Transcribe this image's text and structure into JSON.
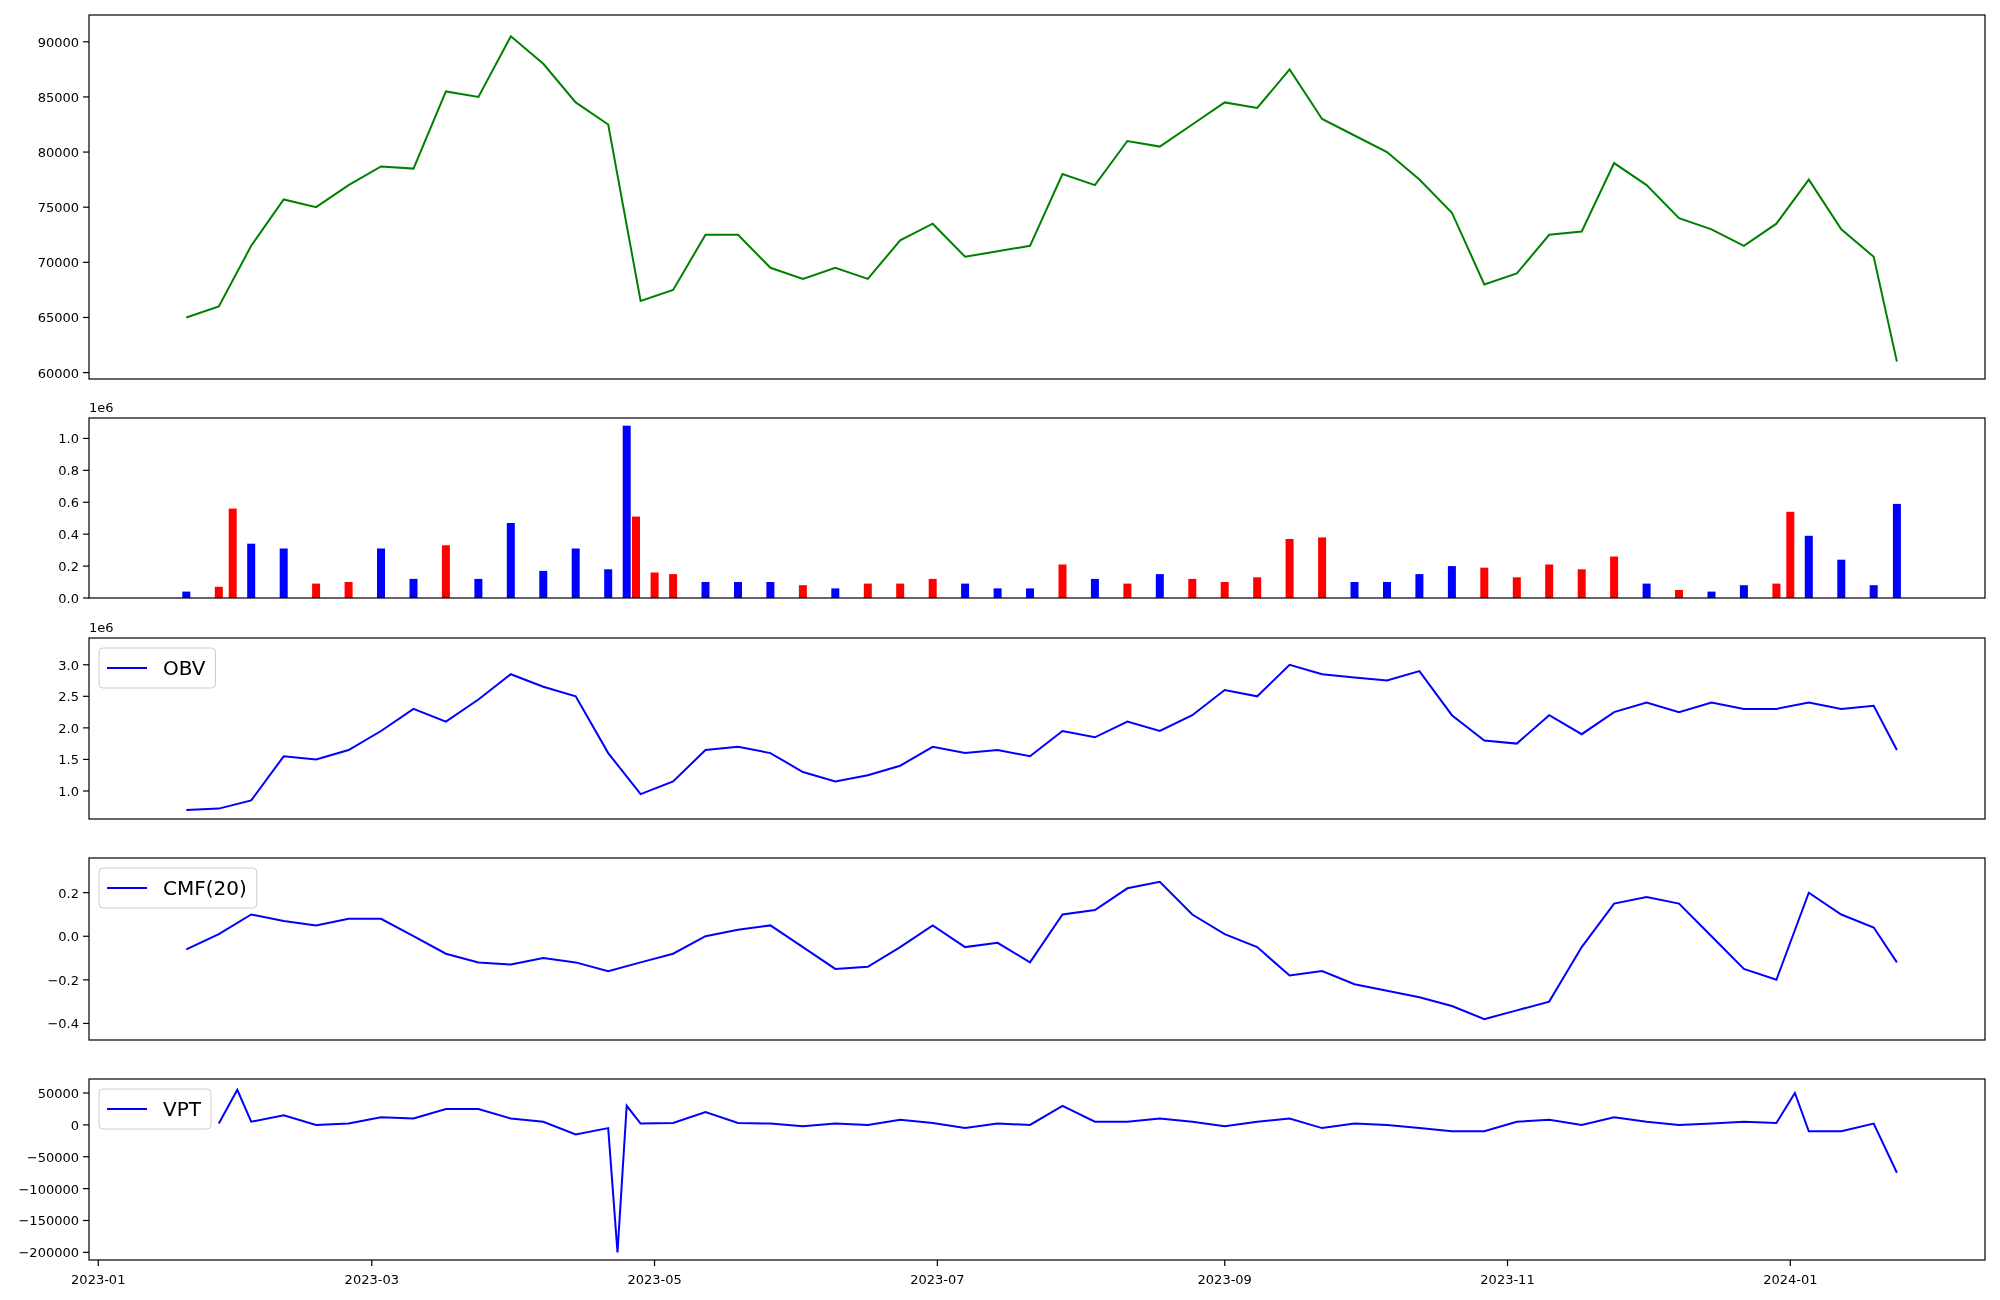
{
  "panels": [
    {
      "chart_data": {
        "type": "line",
        "x": [
          "2023-01-20",
          "2023-01-27",
          "2023-02-03",
          "2023-02-10",
          "2023-02-17",
          "2023-02-24",
          "2023-03-03",
          "2023-03-10",
          "2023-03-17",
          "2023-03-24",
          "2023-03-31",
          "2023-04-07",
          "2023-04-14",
          "2023-04-21",
          "2023-04-28",
          "2023-05-05",
          "2023-05-12",
          "2023-05-19",
          "2023-05-26",
          "2023-06-02",
          "2023-06-09",
          "2023-06-16",
          "2023-06-23",
          "2023-06-30",
          "2023-07-07",
          "2023-07-14",
          "2023-07-21",
          "2023-07-28",
          "2023-08-04",
          "2023-08-11",
          "2023-08-18",
          "2023-08-25",
          "2023-09-01",
          "2023-09-08",
          "2023-09-15",
          "2023-09-22",
          "2023-09-29",
          "2023-10-06",
          "2023-10-13",
          "2023-10-20",
          "2023-10-27",
          "2023-11-03",
          "2023-11-10",
          "2023-11-17",
          "2023-11-24",
          "2023-12-01",
          "2023-12-08",
          "2023-12-15",
          "2023-12-22",
          "2023-12-29",
          "2024-01-05",
          "2024-01-12",
          "2024-01-19",
          "2024-01-24"
        ],
        "series": [
          {
            "color": "#008000",
            "values": [
              65000,
              66000,
              71500,
              75700,
              75000,
              77000,
              78700,
              78500,
              85500,
              85000,
              90500,
              88000,
              84500,
              82500,
              66500,
              67500,
              72500,
              72500,
              69500,
              68500,
              69500,
              68500,
              72000,
              73500,
              70500,
              71000,
              71500,
              78000,
              77000,
              81000,
              80500,
              82500,
              84500,
              84000,
              87500,
              83000,
              81500,
              80000,
              77500,
              74500,
              68000,
              69000,
              72500,
              72800,
              79000,
              77000,
              74000,
              73000,
              71500,
              73500,
              77500,
              73000,
              70500,
              61000
            ]
          }
        ],
        "xlim": [
          "2022-12-30",
          "2024-02-12"
        ],
        "ylim": [
          59420,
          92430
        ],
        "yticks": [
          60000,
          65000,
          70000,
          75000,
          80000,
          85000,
          90000
        ]
      }
    },
    {
      "offset_label": "1e6",
      "chart_data": {
        "type": "bar",
        "x": [
          "2023-01-20",
          "2023-01-27",
          "2023-01-30",
          "2023-02-03",
          "2023-02-10",
          "2023-02-17",
          "2023-02-24",
          "2023-03-03",
          "2023-03-10",
          "2023-03-17",
          "2023-03-24",
          "2023-03-31",
          "2023-04-07",
          "2023-04-14",
          "2023-04-21",
          "2023-04-25",
          "2023-04-27",
          "2023-05-01",
          "2023-05-05",
          "2023-05-12",
          "2023-05-19",
          "2023-05-26",
          "2023-06-02",
          "2023-06-09",
          "2023-06-16",
          "2023-06-23",
          "2023-06-30",
          "2023-07-07",
          "2023-07-14",
          "2023-07-21",
          "2023-07-28",
          "2023-08-04",
          "2023-08-11",
          "2023-08-18",
          "2023-08-25",
          "2023-09-01",
          "2023-09-08",
          "2023-09-15",
          "2023-09-22",
          "2023-09-29",
          "2023-10-06",
          "2023-10-13",
          "2023-10-20",
          "2023-10-27",
          "2023-11-03",
          "2023-11-10",
          "2023-11-17",
          "2023-11-24",
          "2023-12-01",
          "2023-12-08",
          "2023-12-15",
          "2023-12-22",
          "2023-12-29",
          "2024-01-01",
          "2024-01-05",
          "2024-01-12",
          "2024-01-19",
          "2024-01-24"
        ],
        "series": [
          {
            "color": "#0000ff",
            "values": [
              0.04,
              null,
              null,
              0.34,
              0.31,
              null,
              null,
              0.31,
              0.12,
              null,
              0.12,
              0.47,
              0.17,
              0.31,
              0.18,
              1.08,
              null,
              null,
              null,
              0.1,
              0.1,
              0.1,
              null,
              0.06,
              null,
              null,
              null,
              0.09,
              0.06,
              0.06,
              null,
              0.12,
              null,
              0.15,
              null,
              null,
              null,
              null,
              null,
              0.1,
              0.1,
              0.15,
              0.2,
              null,
              null,
              null,
              null,
              null,
              0.09,
              null,
              0.04,
              0.08,
              null,
              null,
              0.39,
              0.24,
              0.08,
              0.59
            ]
          },
          {
            "color": "#ff0000",
            "values": [
              null,
              0.07,
              0.56,
              null,
              null,
              0.09,
              0.1,
              null,
              null,
              0.33,
              null,
              null,
              null,
              null,
              null,
              null,
              0.51,
              0.16,
              0.15,
              null,
              null,
              null,
              0.08,
              null,
              0.09,
              0.09,
              0.12,
              null,
              null,
              null,
              0.21,
              null,
              0.09,
              null,
              0.12,
              0.1,
              0.13,
              0.37,
              0.38,
              null,
              null,
              null,
              null,
              0.19,
              0.13,
              0.21,
              0.18,
              0.26,
              null,
              0.05,
              null,
              null,
              0.09,
              0.54,
              null,
              null,
              null,
              null
            ]
          }
        ],
        "xlim": [
          "2022-12-30",
          "2024-02-12"
        ],
        "ylim": [
          0,
          1.128
        ],
        "yticks": [
          {
            "value": 0,
            "label": "0.0"
          },
          {
            "value": 0.2,
            "label": "0.2"
          },
          {
            "value": 0.4,
            "label": "0.4"
          },
          {
            "value": 0.6,
            "label": "0.6"
          },
          {
            "value": 0.8,
            "label": "0.8"
          },
          {
            "value": 1,
            "label": "1.0"
          }
        ]
      }
    },
    {
      "offset_label": "1e6",
      "chart_data": {
        "type": "line",
        "x": [
          "2023-01-20",
          "2023-01-27",
          "2023-02-03",
          "2023-02-10",
          "2023-02-17",
          "2023-02-24",
          "2023-03-03",
          "2023-03-10",
          "2023-03-17",
          "2023-03-24",
          "2023-03-31",
          "2023-04-07",
          "2023-04-14",
          "2023-04-21",
          "2023-04-28",
          "2023-05-05",
          "2023-05-12",
          "2023-05-19",
          "2023-05-26",
          "2023-06-02",
          "2023-06-09",
          "2023-06-16",
          "2023-06-23",
          "2023-06-30",
          "2023-07-07",
          "2023-07-14",
          "2023-07-21",
          "2023-07-28",
          "2023-08-04",
          "2023-08-11",
          "2023-08-18",
          "2023-08-25",
          "2023-09-01",
          "2023-09-08",
          "2023-09-15",
          "2023-09-22",
          "2023-09-29",
          "2023-10-06",
          "2023-10-13",
          "2023-10-20",
          "2023-10-27",
          "2023-11-03",
          "2023-11-10",
          "2023-11-17",
          "2023-11-24",
          "2023-12-01",
          "2023-12-08",
          "2023-12-15",
          "2023-12-22",
          "2023-12-29",
          "2024-01-05",
          "2024-01-12",
          "2024-01-19",
          "2024-01-24"
        ],
        "series": [
          {
            "name": "OBV",
            "color": "#0000ff",
            "values": [
              0.7,
              0.72,
              0.85,
              1.55,
              1.5,
              1.65,
              1.95,
              2.3,
              2.1,
              2.45,
              2.85,
              2.65,
              2.5,
              1.6,
              0.95,
              1.15,
              1.65,
              1.7,
              1.6,
              1.3,
              1.15,
              1.25,
              1.4,
              1.7,
              1.6,
              1.65,
              1.55,
              1.95,
              1.85,
              2.1,
              1.95,
              2.2,
              2.6,
              2.5,
              3.0,
              2.85,
              2.8,
              2.75,
              2.9,
              2.2,
              1.8,
              1.75,
              2.2,
              1.9,
              2.25,
              2.4,
              2.25,
              2.4,
              2.3,
              2.3,
              2.4,
              2.3,
              2.35,
              1.65
            ]
          }
        ],
        "xlim": [
          "2022-12-30",
          "2024-02-12"
        ],
        "ylim": [
          0.556,
          3.424
        ],
        "yticks": [
          {
            "value": 1,
            "label": "1.0"
          },
          {
            "value": 1.5,
            "label": "1.5"
          },
          {
            "value": 2,
            "label": "2.0"
          },
          {
            "value": 2.5,
            "label": "2.5"
          },
          {
            "value": 3,
            "label": "3.0"
          }
        ]
      }
    },
    {
      "chart_data": {
        "type": "line",
        "x": [
          "2023-01-20",
          "2023-01-27",
          "2023-02-03",
          "2023-02-10",
          "2023-02-17",
          "2023-02-24",
          "2023-03-03",
          "2023-03-10",
          "2023-03-17",
          "2023-03-24",
          "2023-03-31",
          "2023-04-07",
          "2023-04-14",
          "2023-04-21",
          "2023-04-28",
          "2023-05-05",
          "2023-05-12",
          "2023-05-19",
          "2023-05-26",
          "2023-06-02",
          "2023-06-09",
          "2023-06-16",
          "2023-06-23",
          "2023-06-30",
          "2023-07-07",
          "2023-07-14",
          "2023-07-21",
          "2023-07-28",
          "2023-08-04",
          "2023-08-11",
          "2023-08-18",
          "2023-08-25",
          "2023-09-01",
          "2023-09-08",
          "2023-09-15",
          "2023-09-22",
          "2023-09-29",
          "2023-10-06",
          "2023-10-13",
          "2023-10-20",
          "2023-10-27",
          "2023-11-03",
          "2023-11-10",
          "2023-11-17",
          "2023-11-24",
          "2023-12-01",
          "2023-12-08",
          "2023-12-15",
          "2023-12-22",
          "2023-12-29",
          "2024-01-05",
          "2024-01-12",
          "2024-01-19",
          "2024-01-24"
        ],
        "series": [
          {
            "name": "CMF(20)",
            "color": "#0000ff",
            "values": [
              -0.06,
              0.01,
              0.1,
              0.07,
              0.05,
              0.08,
              0.08,
              0.0,
              -0.08,
              -0.12,
              -0.13,
              -0.1,
              -0.12,
              -0.16,
              -0.12,
              -0.08,
              0.0,
              0.03,
              0.05,
              -0.05,
              -0.15,
              -0.14,
              -0.05,
              0.05,
              -0.05,
              -0.03,
              -0.12,
              0.1,
              0.12,
              0.22,
              0.25,
              0.1,
              0.01,
              -0.05,
              -0.18,
              -0.16,
              -0.22,
              -0.25,
              -0.28,
              -0.32,
              -0.38,
              -0.34,
              -0.3,
              -0.05,
              0.15,
              0.18,
              0.15,
              0.0,
              -0.15,
              -0.2,
              0.2,
              0.1,
              0.04,
              -0.12
            ]
          }
        ],
        "xlim": [
          "2022-12-30",
          "2024-02-12"
        ],
        "ylim": [
          -0.476,
          0.359
        ],
        "yticks": [
          {
            "value": -0.4,
            "label": "−0.4"
          },
          {
            "value": -0.2,
            "label": "−0.2"
          },
          {
            "value": 0,
            "label": "0.0"
          },
          {
            "value": 0.2,
            "label": "0.2"
          }
        ]
      }
    },
    {
      "chart_data": {
        "type": "line",
        "x": [
          "2023-01-27",
          "2023-01-31",
          "2023-02-03",
          "2023-02-10",
          "2023-02-17",
          "2023-02-24",
          "2023-03-03",
          "2023-03-10",
          "2023-03-17",
          "2023-03-24",
          "2023-03-31",
          "2023-04-07",
          "2023-04-14",
          "2023-04-21",
          "2023-04-23",
          "2023-04-25",
          "2023-04-28",
          "2023-05-05",
          "2023-05-12",
          "2023-05-19",
          "2023-05-26",
          "2023-06-02",
          "2023-06-09",
          "2023-06-16",
          "2023-06-23",
          "2023-06-30",
          "2023-07-07",
          "2023-07-14",
          "2023-07-21",
          "2023-07-28",
          "2023-08-04",
          "2023-08-11",
          "2023-08-18",
          "2023-08-25",
          "2023-09-01",
          "2023-09-08",
          "2023-09-15",
          "2023-09-22",
          "2023-09-29",
          "2023-10-06",
          "2023-10-13",
          "2023-10-20",
          "2023-10-27",
          "2023-11-03",
          "2023-11-10",
          "2023-11-17",
          "2023-11-24",
          "2023-12-01",
          "2023-12-08",
          "2023-12-15",
          "2023-12-22",
          "2023-12-29",
          "2024-01-02",
          "2024-01-05",
          "2024-01-12",
          "2024-01-19",
          "2024-01-24"
        ],
        "series": [
          {
            "name": "VPT",
            "color": "#0000ff",
            "values": [
              2000,
              55000,
              5000,
              15000,
              0,
              2000,
              12000,
              10000,
              25000,
              25000,
              10000,
              5000,
              -15000,
              -5000,
              -200000,
              30000,
              2000,
              3000,
              20000,
              3000,
              2000,
              -2000,
              2000,
              0,
              8000,
              3000,
              -5000,
              2000,
              0,
              30000,
              5000,
              5000,
              10000,
              5000,
              -2000,
              5000,
              10000,
              -5000,
              2000,
              0,
              -5000,
              -10000,
              -10000,
              5000,
              8000,
              0,
              12000,
              5000,
              0,
              2000,
              5000,
              3000,
              50000,
              -10000,
              -10000,
              2000,
              -75000
            ]
          }
        ],
        "xlim": [
          "2022-12-30",
          "2024-02-12"
        ],
        "ylim": [
          -212000,
          72000
        ],
        "yticks": [
          {
            "value": -200000,
            "label": "−200000"
          },
          {
            "value": -150000,
            "label": "−150000"
          },
          {
            "value": -100000,
            "label": "−100000"
          },
          {
            "value": -50000,
            "label": "−50000"
          },
          {
            "value": 0,
            "label": "0"
          },
          {
            "value": 50000,
            "label": "50000"
          }
        ],
        "xticks": [
          {
            "value": "2023-01-01",
            "label": "2023-01"
          },
          {
            "value": "2023-03-01",
            "label": "2023-03"
          },
          {
            "value": "2023-05-01",
            "label": "2023-05"
          },
          {
            "value": "2023-07-01",
            "label": "2023-07"
          },
          {
            "value": "2023-09-01",
            "label": "2023-09"
          },
          {
            "value": "2023-11-01",
            "label": "2023-11"
          },
          {
            "value": "2024-01-01",
            "label": "2024-01"
          }
        ]
      }
    }
  ]
}
